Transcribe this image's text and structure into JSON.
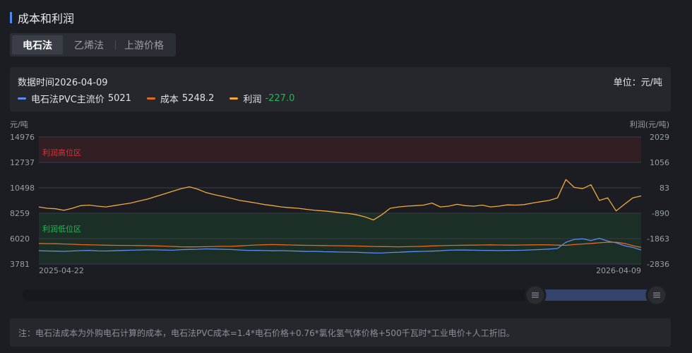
{
  "header": {
    "title": "成本和利润"
  },
  "tabs": [
    {
      "label": "电石法",
      "active": true
    },
    {
      "label": "乙烯法",
      "active": false
    },
    {
      "label": "上游价格",
      "active": false
    }
  ],
  "info": {
    "date_label": "数据时间2026-04-09",
    "unit_label": "单位：元/吨"
  },
  "legend": [
    {
      "name": "电石法PVC主流价",
      "value": "5021",
      "color": "#5b8def"
    },
    {
      "name": "成本",
      "value": "5248.2",
      "color": "#e8681f"
    },
    {
      "name": "利润",
      "value": "-227.0",
      "color": "#f2a93b",
      "value_color": "#1db954"
    }
  ],
  "note": "注：电石法成本为外购电石计算的成本，电石法PVC成本=1.4*电石价格+0.76*氯化氢气体价格+500千瓦时*工业电价+人工折旧。",
  "chart_data": {
    "type": "line",
    "x_start": "2025-04-22",
    "x_end": "2026-04-09",
    "left_axis": {
      "label": "元/吨",
      "ticks": [
        "14976",
        "12737",
        "10498",
        "8259",
        "6020",
        "3781"
      ],
      "min": 3781,
      "max": 14976
    },
    "right_axis": {
      "label": "利润(元/吨)",
      "ticks": [
        "2029",
        "1056",
        "83",
        "-890",
        "-1863",
        "-2836"
      ],
      "min": -2836,
      "max": 2029
    },
    "bands": [
      {
        "label": "利润高位区",
        "from": 1056,
        "to": 2029,
        "axis": "right",
        "color": "#e0303a"
      },
      {
        "label": "利润低位区",
        "from": -2836,
        "to": -890,
        "axis": "right",
        "color": "#1db954"
      }
    ],
    "series": [
      {
        "name": "电石法PVC主流价",
        "axis": "left",
        "color": "#5b8def",
        "values": [
          4950,
          4930,
          4920,
          4900,
          4930,
          4960,
          4980,
          4940,
          4930,
          4950,
          4980,
          5000,
          5020,
          5040,
          5030,
          5010,
          5000,
          5050,
          5070,
          5080,
          5120,
          5100,
          5080,
          5060,
          5020,
          4990,
          4980,
          4970,
          4950,
          4960,
          4940,
          4920,
          4890,
          4900,
          4870,
          4860,
          4840,
          4830,
          4820,
          4780,
          4760,
          4750,
          4800,
          4820,
          4860,
          4880,
          4900,
          4920,
          4950,
          5000,
          5020,
          5010,
          5000,
          4990,
          4980,
          4970,
          4980,
          4990,
          5000,
          5030,
          5060,
          5100,
          5150,
          5700,
          5950,
          6000,
          5850,
          6050,
          5800,
          5650,
          5400,
          5250,
          5021
        ]
      },
      {
        "name": "成本",
        "axis": "left",
        "color": "#e8681f",
        "values": [
          5600,
          5580,
          5570,
          5550,
          5520,
          5490,
          5480,
          5460,
          5440,
          5430,
          5420,
          5420,
          5410,
          5400,
          5380,
          5360,
          5330,
          5300,
          5290,
          5300,
          5310,
          5330,
          5340,
          5350,
          5380,
          5420,
          5460,
          5480,
          5500,
          5480,
          5460,
          5440,
          5430,
          5420,
          5410,
          5400,
          5390,
          5380,
          5370,
          5350,
          5330,
          5320,
          5310,
          5300,
          5310,
          5330,
          5350,
          5380,
          5400,
          5420,
          5430,
          5440,
          5450,
          5460,
          5470,
          5460,
          5450,
          5450,
          5460,
          5470,
          5480,
          5470,
          5450,
          5430,
          5500,
          5550,
          5600,
          5650,
          5700,
          5700,
          5600,
          5400,
          5248.2
        ]
      },
      {
        "name": "利润",
        "axis": "right",
        "color": "#f2a93b",
        "values": [
          -650,
          -700,
          -720,
          -780,
          -700,
          -600,
          -580,
          -620,
          -650,
          -600,
          -550,
          -500,
          -420,
          -350,
          -250,
          -150,
          -50,
          50,
          120,
          30,
          -100,
          -180,
          -250,
          -320,
          -400,
          -450,
          -500,
          -560,
          -600,
          -650,
          -680,
          -700,
          -740,
          -780,
          -800,
          -830,
          -870,
          -900,
          -950,
          -1030,
          -1150,
          -950,
          -700,
          -650,
          -620,
          -600,
          -580,
          -500,
          -650,
          -620,
          -550,
          -600,
          -620,
          -580,
          -650,
          -620,
          -570,
          -580,
          -560,
          -500,
          -450,
          -400,
          -300,
          400,
          100,
          50,
          200,
          -400,
          -300,
          -800,
          -550,
          -300,
          -227
        ]
      }
    ]
  }
}
